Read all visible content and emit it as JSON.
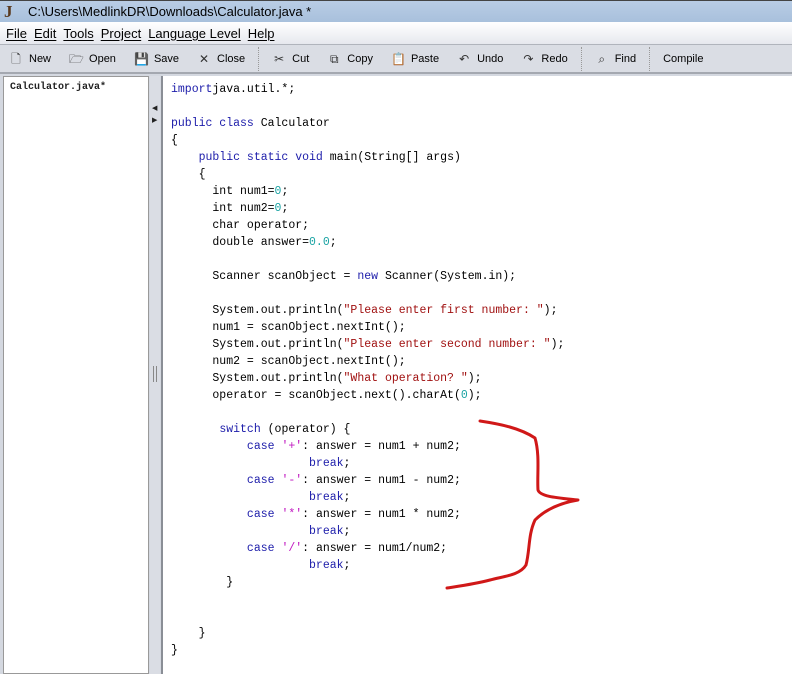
{
  "title": "C:\\Users\\MedlinkDR\\Downloads\\Calculator.java *",
  "menu": [
    "File",
    "Edit",
    "Tools",
    "Project",
    "Language Level",
    "Help"
  ],
  "toolbar": [
    {
      "label": "New",
      "icon": "new-file-icon",
      "glyph": "🗋"
    },
    {
      "label": "Open",
      "icon": "open-folder-icon",
      "glyph": "🗁"
    },
    {
      "label": "Save",
      "icon": "save-icon",
      "glyph": "💾"
    },
    {
      "label": "Close",
      "icon": "close-file-icon",
      "glyph": "✕"
    },
    {
      "label": "Cut",
      "icon": "scissors-icon",
      "glyph": "✂"
    },
    {
      "label": "Copy",
      "icon": "copy-icon",
      "glyph": "⧉"
    },
    {
      "label": "Paste",
      "icon": "clipboard-icon",
      "glyph": "📋"
    },
    {
      "label": "Undo",
      "icon": "undo-icon",
      "glyph": "↶"
    },
    {
      "label": "Redo",
      "icon": "redo-icon",
      "glyph": "↷"
    },
    {
      "label": "Find",
      "icon": "binoculars-icon",
      "glyph": "⌕"
    },
    {
      "label": "Compile",
      "icon": "",
      "glyph": ""
    }
  ],
  "open_files": [
    "Calculator.java*"
  ],
  "code": [
    [
      [
        "kw",
        "import"
      ],
      [
        "",
        "java.util.*;"
      ]
    ],
    [],
    [
      [
        "kw",
        "public class"
      ],
      [
        "",
        " Calculator"
      ]
    ],
    [
      [
        "",
        "{"
      ]
    ],
    [
      [
        "",
        "    "
      ],
      [
        "kw",
        "public static void"
      ],
      [
        "",
        " main(String[] args)"
      ]
    ],
    [
      [
        "",
        "    {"
      ]
    ],
    [
      [
        "",
        "      int num1="
      ],
      [
        "num",
        "0"
      ],
      [
        "",
        ";"
      ]
    ],
    [
      [
        "",
        "      int num2="
      ],
      [
        "num",
        "0"
      ],
      [
        "",
        ";"
      ]
    ],
    [
      [
        "",
        "      char operator;"
      ]
    ],
    [
      [
        "",
        "      double answer="
      ],
      [
        "num",
        "0.0"
      ],
      [
        "",
        ";"
      ]
    ],
    [],
    [
      [
        "",
        "      Scanner scanObject = "
      ],
      [
        "kw",
        "new"
      ],
      [
        "",
        " Scanner(System.in);"
      ]
    ],
    [],
    [
      [
        "",
        "      System.out.println("
      ],
      [
        "str",
        "\"Please enter first number: \""
      ],
      [
        "",
        ");"
      ]
    ],
    [
      [
        "",
        "      num1 = scanObject.nextInt();"
      ]
    ],
    [
      [
        "",
        "      System.out.println("
      ],
      [
        "str",
        "\"Please enter second number: \""
      ],
      [
        "",
        ");"
      ]
    ],
    [
      [
        "",
        "      num2 = scanObject.nextInt();"
      ]
    ],
    [
      [
        "",
        "      System.out.println("
      ],
      [
        "str",
        "\"What operation? \""
      ],
      [
        "",
        ");"
      ]
    ],
    [
      [
        "",
        "      operator = scanObject.next().charAt("
      ],
      [
        "num",
        "0"
      ],
      [
        "",
        ");"
      ]
    ],
    [],
    [
      [
        "",
        "       "
      ],
      [
        "kw",
        "switch"
      ],
      [
        "",
        " (operator) {"
      ]
    ],
    [
      [
        "",
        "           "
      ],
      [
        "kw",
        "case"
      ],
      [
        "",
        " "
      ],
      [
        "chr",
        "'+'"
      ],
      [
        "",
        ": answer = num1 + num2;"
      ]
    ],
    [
      [
        "",
        "                    "
      ],
      [
        "kw",
        "break"
      ],
      [
        "",
        ";"
      ]
    ],
    [
      [
        "",
        "           "
      ],
      [
        "kw",
        "case"
      ],
      [
        "",
        " "
      ],
      [
        "chr",
        "'-'"
      ],
      [
        "",
        ": answer = num1 - num2;"
      ]
    ],
    [
      [
        "",
        "                    "
      ],
      [
        "kw",
        "break"
      ],
      [
        "",
        ";"
      ]
    ],
    [
      [
        "",
        "           "
      ],
      [
        "kw",
        "case"
      ],
      [
        "",
        " "
      ],
      [
        "chr",
        "'*'"
      ],
      [
        "",
        ": answer = num1 * num2;"
      ]
    ],
    [
      [
        "",
        "                    "
      ],
      [
        "kw",
        "break"
      ],
      [
        "",
        ";"
      ]
    ],
    [
      [
        "",
        "           "
      ],
      [
        "kw",
        "case"
      ],
      [
        "",
        " "
      ],
      [
        "chr",
        "'/'"
      ],
      [
        "",
        ": answer = num1/num2;"
      ]
    ],
    [
      [
        "",
        "                    "
      ],
      [
        "kw",
        "break"
      ],
      [
        "",
        ";"
      ]
    ],
    [
      [
        "",
        "        }"
      ]
    ],
    [],
    [],
    [
      [
        "",
        "    }"
      ]
    ],
    [
      [
        "",
        "}"
      ]
    ]
  ],
  "annotation_color": "#d01818"
}
